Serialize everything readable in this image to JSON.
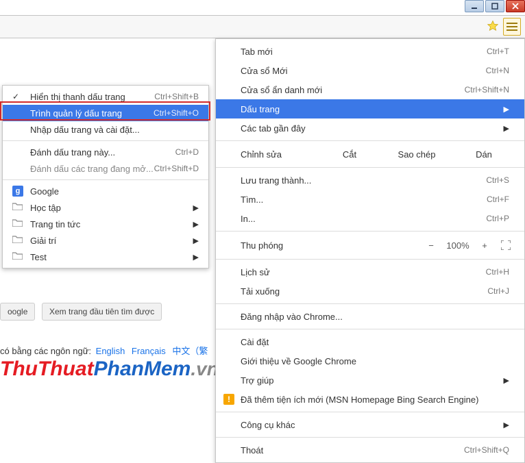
{
  "main_menu": {
    "new_tab": "Tab mới",
    "new_tab_sc": "Ctrl+T",
    "new_window": "Cửa sổ Mới",
    "new_window_sc": "Ctrl+N",
    "incognito": "Cửa sổ ẩn danh mới",
    "incognito_sc": "Ctrl+Shift+N",
    "bookmarks": "Dấu trang",
    "recent_tabs": "Các tab gần đây",
    "edit_label": "Chỉnh sửa",
    "cut": "Cắt",
    "copy": "Sao chép",
    "paste": "Dán",
    "save_page": "Lưu trang thành...",
    "save_page_sc": "Ctrl+S",
    "find": "Tìm...",
    "find_sc": "Ctrl+F",
    "print": "In...",
    "print_sc": "Ctrl+P",
    "zoom_label": "Thu phóng",
    "zoom_minus": "−",
    "zoom_val": "100%",
    "zoom_plus": "+",
    "history": "Lịch sử",
    "history_sc": "Ctrl+H",
    "downloads": "Tải xuống",
    "downloads_sc": "Ctrl+J",
    "signin": "Đăng nhập vào Chrome...",
    "settings": "Cài đặt",
    "about": "Giới thiệu về Google Chrome",
    "help": "Trợ giúp",
    "ext_added": "Đã thêm tiện ích mới (MSN Homepage  Bing Search Engine)",
    "tools": "Công cụ khác",
    "exit": "Thoát",
    "exit_sc": "Ctrl+Shift+Q"
  },
  "sub_menu": {
    "show_bar": "Hiển thị thanh dấu trang",
    "show_bar_sc": "Ctrl+Shift+B",
    "manager": "Trình quản lý dấu trang",
    "manager_sc": "Ctrl+Shift+O",
    "import": "Nhập dấu trang và cài đặt...",
    "bookmark_this": "Đánh dấu trang này...",
    "bookmark_this_sc": "Ctrl+D",
    "bookmark_open": "Đánh dấu các trang đang mở...",
    "bookmark_open_sc": "Ctrl+Shift+D",
    "google": "Google",
    "study": "Học tập",
    "news": "Trang tin tức",
    "entertainment": "Giải trí",
    "test": "Test"
  },
  "page": {
    "btn_left": "oogle",
    "btn_right": "Xem trang đầu tiên tìm được",
    "lang_text": "có bằng các ngôn ngữ:",
    "lang_en": "English",
    "lang_fr": "Français",
    "lang_zh": "中文（繁",
    "brand_a": "ThuThuat",
    "brand_b": "PhanMem",
    "brand_c": ".vn"
  }
}
